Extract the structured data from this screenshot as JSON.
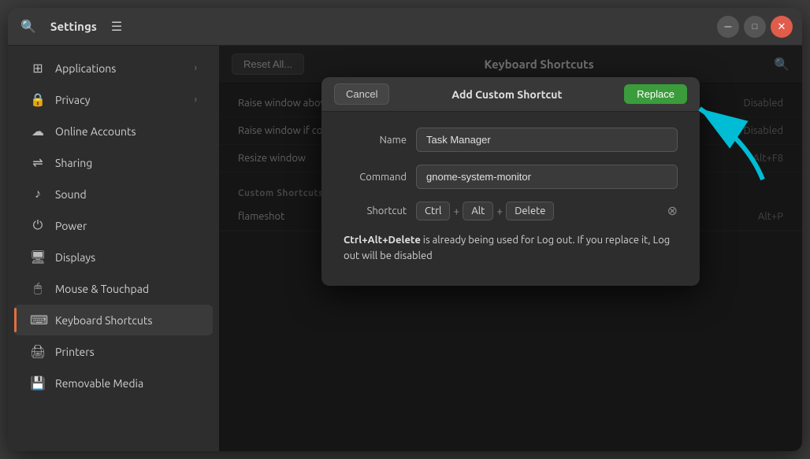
{
  "window": {
    "title": "Settings"
  },
  "panel": {
    "title": "Keyboard Shortcuts",
    "reset_label": "Reset All...",
    "search_icon": "🔍"
  },
  "sidebar": {
    "items": [
      {
        "id": "applications",
        "label": "Applications",
        "icon": "⊞",
        "has_arrow": true
      },
      {
        "id": "privacy",
        "label": "Privacy",
        "icon": "🔒",
        "has_arrow": true
      },
      {
        "id": "online-accounts",
        "label": "Online Accounts",
        "icon": "☁",
        "has_arrow": false
      },
      {
        "id": "sharing",
        "label": "Sharing",
        "icon": "⇌",
        "has_arrow": false
      },
      {
        "id": "sound",
        "label": "Sound",
        "icon": "♪",
        "has_arrow": false
      },
      {
        "id": "power",
        "label": "Power",
        "icon": "⏻",
        "has_arrow": false
      },
      {
        "id": "displays",
        "label": "Displays",
        "icon": "🖥",
        "has_arrow": false
      },
      {
        "id": "mouse-touchpad",
        "label": "Mouse & Touchpad",
        "icon": "🖱",
        "has_arrow": false
      },
      {
        "id": "keyboard-shortcuts",
        "label": "Keyboard Shortcuts",
        "icon": "⌨",
        "has_arrow": false,
        "active": true
      },
      {
        "id": "printers",
        "label": "Printers",
        "icon": "🖨",
        "has_arrow": false
      },
      {
        "id": "removable-media",
        "label": "Removable Media",
        "icon": "💾",
        "has_arrow": false
      }
    ]
  },
  "shortcuts": {
    "rows": [
      {
        "name": "Raise window above other windows",
        "key": "Disabled"
      },
      {
        "name": "Raise window if covered, otherwise lower it",
        "key": "Disabled"
      },
      {
        "name": "Resize window",
        "key": "Alt+F8"
      }
    ],
    "custom_section": "Custom Shortcuts",
    "custom_rows": [
      {
        "name": "flameshot",
        "key": "Alt+P"
      }
    ],
    "add_icon": "+"
  },
  "dialog": {
    "title": "Add Custom Shortcut",
    "cancel_label": "Cancel",
    "replace_label": "Replace",
    "name_label": "Name",
    "name_value": "Task Manager",
    "command_label": "Command",
    "command_value": "gnome-system-monitor",
    "shortcut_label": "Shortcut",
    "keys": [
      "Ctrl",
      "+",
      "Alt",
      "+",
      "Delete"
    ],
    "warning": "Ctrl+Alt+Delete is already being used for Log out. If you replace it, Log out will be disabled"
  }
}
